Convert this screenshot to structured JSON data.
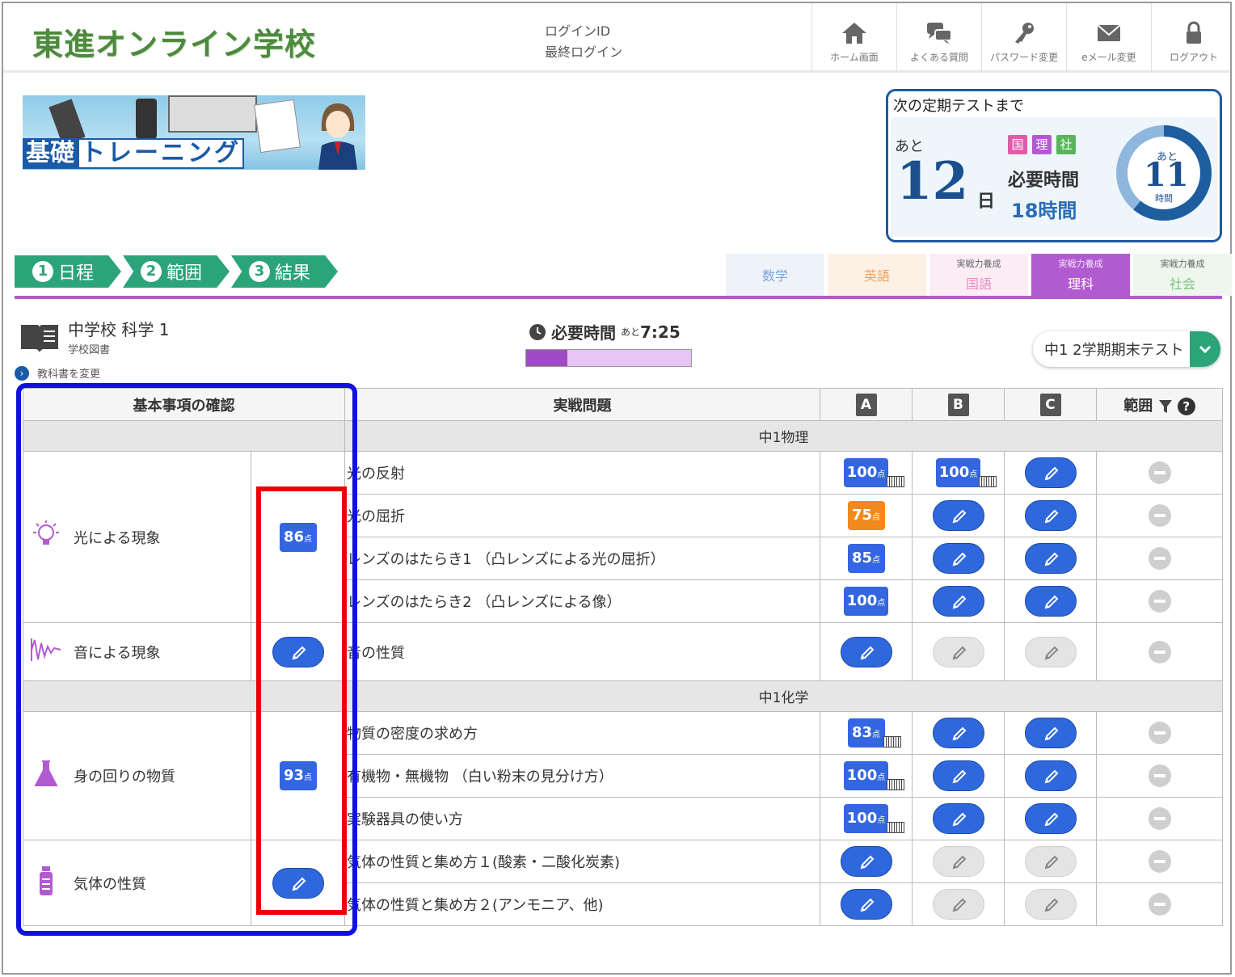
{
  "header": {
    "logo": "東進オンライン学校",
    "login_id_label": "ログインID",
    "last_login_label": "最終ログイン",
    "nav": [
      {
        "label": "ホーム画面",
        "icon": "home-icon"
      },
      {
        "label": "よくある質問",
        "icon": "chat-icon"
      },
      {
        "label": "パスワード変更",
        "icon": "key-icon"
      },
      {
        "label": "eメール変更",
        "icon": "mail-icon"
      },
      {
        "label": "ログアウト",
        "icon": "lock-icon"
      }
    ]
  },
  "banner": {
    "title_a": "基礎",
    "title_b": "トレーニング"
  },
  "countdown": {
    "title": "次の定期テストまで",
    "ato": "あと",
    "days": "12",
    "day_unit": "日",
    "tags": [
      {
        "label": "国",
        "color": "#e25aa9"
      },
      {
        "label": "理",
        "color": "#b25bd1"
      },
      {
        "label": "社",
        "color": "#5ab55a"
      }
    ],
    "required_label": "必要時間",
    "required_hours": "18時間",
    "ring_ato": "あと",
    "ring_value": "11",
    "ring_unit": "時間",
    "ring_fraction": 0.61
  },
  "steps": [
    {
      "num": "1",
      "label": "日程"
    },
    {
      "num": "2",
      "label": "範囲"
    },
    {
      "num": "3",
      "label": "結果"
    }
  ],
  "subject_tabs": [
    {
      "sub": "",
      "label": "数学",
      "bg": "#eef3fa",
      "color": "#7aa6d8",
      "active": false
    },
    {
      "sub": "",
      "label": "英語",
      "bg": "#fdf1e6",
      "color": "#f2a05a",
      "active": false
    },
    {
      "sub": "実戦力養成",
      "label": "国語",
      "bg": "#fcedf5",
      "color": "#e58cc0",
      "active": false
    },
    {
      "sub": "実戦力養成",
      "label": "理科",
      "bg": "#b25bd1",
      "color": "#ffffff",
      "active": true
    },
    {
      "sub": "実戦力養成",
      "label": "社会",
      "bg": "#eef7ee",
      "color": "#7cc07c",
      "active": false
    }
  ],
  "book": {
    "title": "中学校 科学 1",
    "publisher": "学校図書",
    "change_label": "教科書を変更"
  },
  "required": {
    "label": "必要時間",
    "remaining_prefix": "あと",
    "remaining": "7:25",
    "progress": 0.25
  },
  "test_select": {
    "value": "中1 2学期期末テスト"
  },
  "table": {
    "headers": {
      "basic": "基本事項の確認",
      "practice": "実戦問題",
      "a": "A",
      "b": "B",
      "c": "C",
      "range": "範囲"
    },
    "sections": [
      {
        "name": "中1物理",
        "categories": [
          {
            "label": "光による現象",
            "icon": "bulb-icon",
            "score": "86",
            "rows": [
              {
                "title": "光の反射",
                "a": {
                  "t": "score",
                  "v": "100",
                  "vid": true
                },
                "b": {
                  "t": "score",
                  "v": "100",
                  "vid": true
                },
                "c": {
                  "t": "pen"
                }
              },
              {
                "title": "光の屈折",
                "a": {
                  "t": "score",
                  "v": "75",
                  "orange": true
                },
                "b": {
                  "t": "pen"
                },
                "c": {
                  "t": "pen"
                }
              },
              {
                "title": "レンズのはたらき1 （凸レンズによる光の屈折）",
                "a": {
                  "t": "score",
                  "v": "85"
                },
                "b": {
                  "t": "pen"
                },
                "c": {
                  "t": "pen"
                }
              },
              {
                "title": "レンズのはたらき2 （凸レンズによる像）",
                "a": {
                  "t": "score",
                  "v": "100"
                },
                "b": {
                  "t": "pen"
                },
                "c": {
                  "t": "pen"
                }
              }
            ]
          },
          {
            "label": "音による現象",
            "icon": "wave-icon",
            "score": "",
            "rows": [
              {
                "title": "音の性質",
                "a": {
                  "t": "pen"
                },
                "b": {
                  "t": "gray"
                },
                "c": {
                  "t": "gray"
                },
                "tall": true
              }
            ]
          }
        ]
      },
      {
        "name": "中1化学",
        "categories": [
          {
            "label": "身の回りの物質",
            "icon": "flask-icon",
            "score": "93",
            "rows": [
              {
                "title": "物質の密度の求め方",
                "a": {
                  "t": "score",
                  "v": "83",
                  "vid": true
                },
                "b": {
                  "t": "pen"
                },
                "c": {
                  "t": "pen"
                }
              },
              {
                "title": "有機物・無機物 （白い粉末の見分け方）",
                "a": {
                  "t": "score",
                  "v": "100",
                  "vid": true
                },
                "b": {
                  "t": "pen"
                },
                "c": {
                  "t": "pen"
                }
              },
              {
                "title": "実験器具の使い方",
                "a": {
                  "t": "score",
                  "v": "100",
                  "vid": true
                },
                "b": {
                  "t": "pen"
                },
                "c": {
                  "t": "pen"
                }
              }
            ]
          },
          {
            "label": "気体の性質",
            "icon": "bottle-icon",
            "score": "",
            "rows": [
              {
                "title": "気体の性質と集め方１(酸素・二酸化炭素)",
                "a": {
                  "t": "pen"
                },
                "b": {
                  "t": "gray"
                },
                "c": {
                  "t": "gray"
                }
              },
              {
                "title": "気体の性質と集め方２(アンモニア、他)",
                "a": {
                  "t": "pen"
                },
                "b": {
                  "t": "gray"
                },
                "c": {
                  "t": "gray"
                }
              }
            ]
          }
        ]
      }
    ],
    "score_unit": "点"
  }
}
